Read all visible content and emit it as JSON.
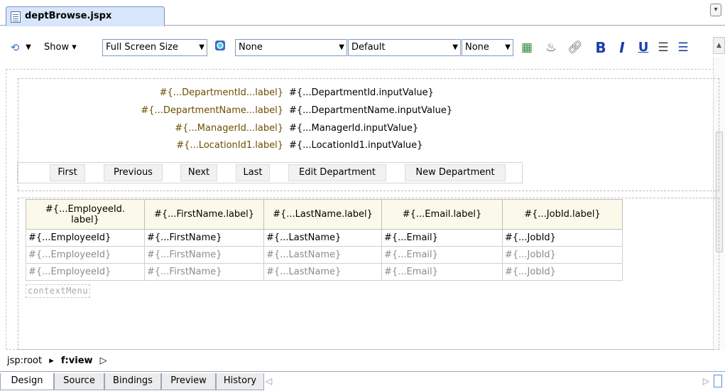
{
  "editor_tab": {
    "title": "deptBrowse.jspx"
  },
  "toolbar": {
    "show_label": "Show",
    "screen_size": "Full Screen Size",
    "style_class": "None",
    "font_name": "Default",
    "font_size": "None",
    "bold_glyph": "B",
    "italic_glyph": "I",
    "underline_glyph": "U"
  },
  "form": {
    "rows": [
      {
        "label": "#{...DepartmentId...label}",
        "value": "#{...DepartmentId.inputValue}"
      },
      {
        "label": "#{...DepartmentName...label}",
        "value": "#{...DepartmentName.inputValue}"
      },
      {
        "label": "#{...ManagerId...label}",
        "value": "#{...ManagerId.inputValue}"
      },
      {
        "label": "#{...LocationId1.label}",
        "value": "#{...LocationId1.inputValue}"
      }
    ],
    "buttons": [
      "First",
      "Previous",
      "Next",
      "Last",
      "Edit Department",
      "New Department"
    ]
  },
  "table": {
    "headers": [
      "#{...EmployeeId.\nlabel}",
      "#{...FirstName.label}",
      "#{...LastName.label}",
      "#{...Email.label}",
      "#{...JobId.label}"
    ],
    "rows": [
      [
        "#{...EmployeeId}",
        "#{...FirstName}",
        "#{...LastName}",
        "#{...Email}",
        "#{...JobId}"
      ],
      [
        "#{...EmployeeId}",
        "#{...FirstName}",
        "#{...LastName}",
        "#{...Email}",
        "#{...JobId}"
      ],
      [
        "#{...EmployeeId}",
        "#{...FirstName}",
        "#{...LastName}",
        "#{...Email}",
        "#{...JobId}"
      ]
    ],
    "context_menu": "contextMenu"
  },
  "breadcrumb": {
    "root": "jsp:root",
    "current": "f:view"
  },
  "bottom_tabs": [
    "Design",
    "Source",
    "Bindings",
    "Preview",
    "History"
  ],
  "colors": {
    "label_text": "#6e4e00",
    "header_bg": "#fbfaea",
    "tab_bg": "#d7e6fb"
  }
}
